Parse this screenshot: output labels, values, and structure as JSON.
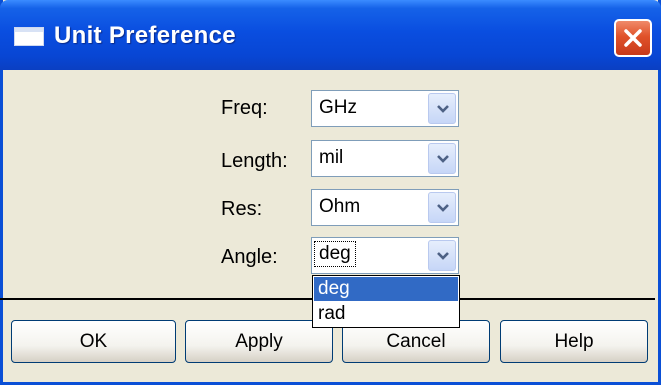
{
  "window": {
    "title": "Unit Preference"
  },
  "fields": [
    {
      "label": "Freq:",
      "value": "GHz"
    },
    {
      "label": "Length:",
      "value": "mil"
    },
    {
      "label": "Res:",
      "value": "Ohm"
    },
    {
      "label": "Angle:",
      "value": "deg"
    }
  ],
  "angle_dropdown": {
    "options": [
      "deg",
      "rad"
    ],
    "highlighted": "deg"
  },
  "buttons": {
    "ok": "OK",
    "apply": "Apply",
    "cancel": "Cancel",
    "help": "Help"
  },
  "colors": {
    "titlebar": "#0a4ee0",
    "dialog_bg": "#ece9d8",
    "selection": "#316ac5"
  }
}
